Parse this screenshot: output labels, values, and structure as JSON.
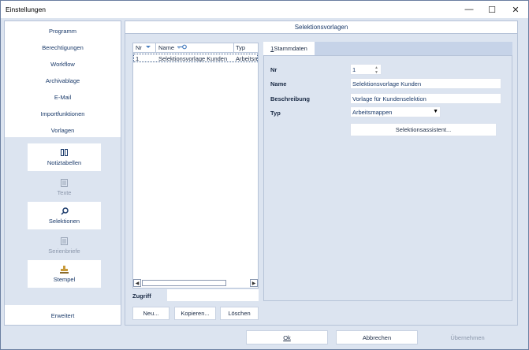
{
  "window": {
    "title": "Einstellungen",
    "minimize": "—",
    "maximize": "☐",
    "close": "✕"
  },
  "sidebar": {
    "items": [
      {
        "label": "Programm"
      },
      {
        "label": "Berechtigungen"
      },
      {
        "label": "Workflow"
      },
      {
        "label": "Archivablage"
      },
      {
        "label": "E-Mail"
      },
      {
        "label": "Importfunktionen"
      },
      {
        "label": "Vorlagen"
      }
    ],
    "subitems": [
      {
        "label": "Notiztabellen",
        "icon": "table-icon",
        "active": true
      },
      {
        "label": "Texte",
        "icon": "document-icon",
        "active": false
      },
      {
        "label": "Selektionen",
        "icon": "search-icon",
        "active": true
      },
      {
        "label": "Serienbriefe",
        "icon": "document-icon",
        "active": false
      },
      {
        "label": "Stempel",
        "icon": "stamp-icon",
        "active": true
      }
    ],
    "footer": "Erweitert"
  },
  "main": {
    "title": "Selektionsvorlagen",
    "list": {
      "columns": [
        "Nr",
        "Name",
        "Typ"
      ],
      "rows": [
        {
          "nr": "1",
          "name": "Selektionsvorlage Kunden",
          "typ": "Arbeitsm"
        }
      ]
    },
    "zugriff_label": "Zugriff",
    "zugriff_value": "",
    "buttons": {
      "neu": "Neu...",
      "kopieren": "Kopieren...",
      "loeschen": "Löschen"
    },
    "tab": {
      "hotkey": "1",
      "label": " Stammdaten"
    },
    "form": {
      "nr_label": "Nr",
      "nr_value": "1",
      "name_label": "Name",
      "name_value": "Selektionsvorlage Kunden",
      "beschreibung_label": "Beschreibung",
      "beschreibung_value": "Vorlage für Kundenselektion",
      "typ_label": "Typ",
      "typ_value": "Arbeitsmappen",
      "assistent_label": "Selektionsassistent..."
    }
  },
  "footer_buttons": {
    "ok": "Ok",
    "abbrechen": "Abbrechen",
    "uebernehmen": "Übernehmen"
  },
  "colors": {
    "accent": "#1a3a6a",
    "background": "#dce4f0",
    "sort_arrow": "#4a7fc0"
  }
}
